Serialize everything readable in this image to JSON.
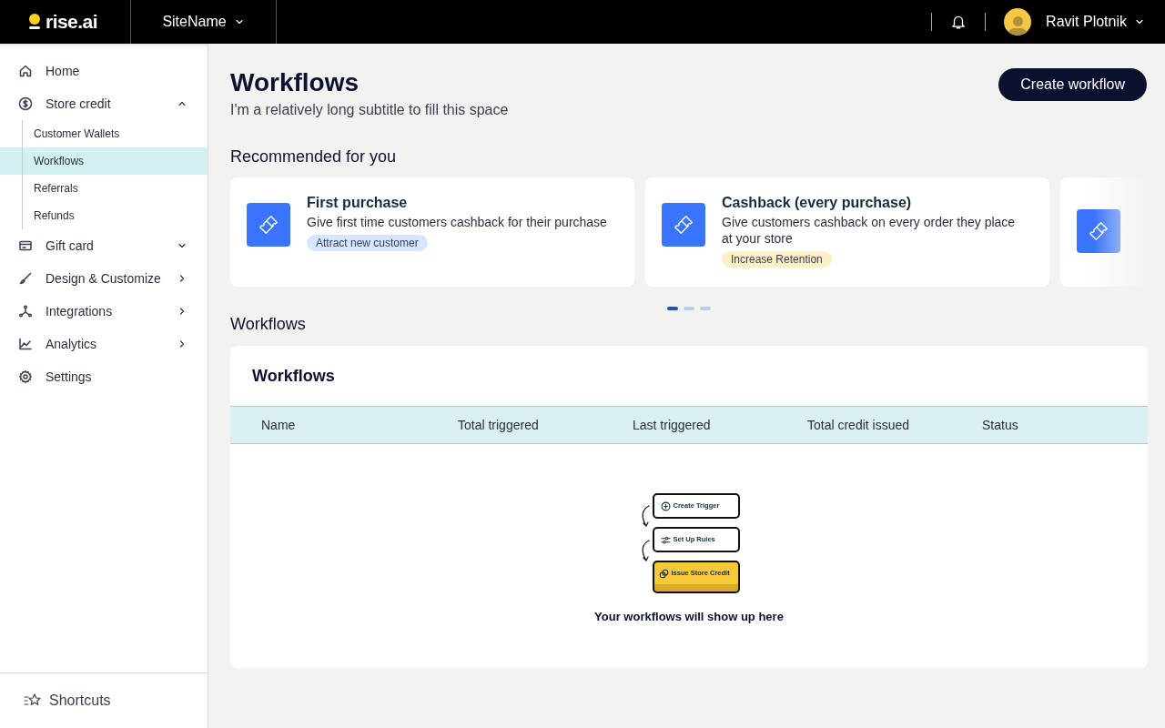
{
  "header": {
    "logo": "rise.ai",
    "site": "SiteName",
    "user": "Ravit Plotnik"
  },
  "sidebar": {
    "items": [
      {
        "label": "Home",
        "kind": "plain"
      },
      {
        "label": "Store credit",
        "kind": "group",
        "expanded": true,
        "children": [
          {
            "label": "Customer Wallets",
            "selected": false
          },
          {
            "label": "Workflows",
            "selected": true
          },
          {
            "label": "Referrals",
            "selected": false
          },
          {
            "label": "Refunds",
            "selected": false
          }
        ]
      },
      {
        "label": "Gift card",
        "kind": "group",
        "expanded": false
      },
      {
        "label": "Design & Customize",
        "kind": "link"
      },
      {
        "label": "Integrations",
        "kind": "link"
      },
      {
        "label": "Analytics",
        "kind": "link"
      },
      {
        "label": "Settings",
        "kind": "plain"
      }
    ],
    "footer": "Shortcuts"
  },
  "page": {
    "title": "Workflows",
    "subtitle": "I'm a relatively long subtitle to fill this space",
    "primary_button": "Create workflow"
  },
  "recommended": {
    "heading": "Recommended for you",
    "cards": [
      {
        "title": "First purchase",
        "description": "Give first time customers cashback for their purchase",
        "tag": "Attract new customer",
        "color": "#d6e6fe"
      },
      {
        "title": "Cashback (every purchase)",
        "description": "Give customers cashback on every order they place at your store",
        "tag": "Increase Retention",
        "color": "#fdf0c4"
      }
    ],
    "dots": [
      {
        "selected": true
      },
      {
        "selected": false
      },
      {
        "selected": false
      }
    ]
  },
  "workflows": {
    "heading": "Workflows",
    "table": {
      "title": "Workflows",
      "columns": [
        "Name",
        "Total triggered",
        "Last triggered",
        "Total credit issued",
        "Status"
      ]
    },
    "empty": {
      "steps": [
        {
          "label": "Create Trigger",
          "kind": "trigger"
        },
        {
          "label": "Set Up Rules",
          "kind": "rules"
        },
        {
          "label": "Issue Store Credit",
          "kind": "credit"
        }
      ],
      "message": "Your workflows will show up here"
    }
  }
}
